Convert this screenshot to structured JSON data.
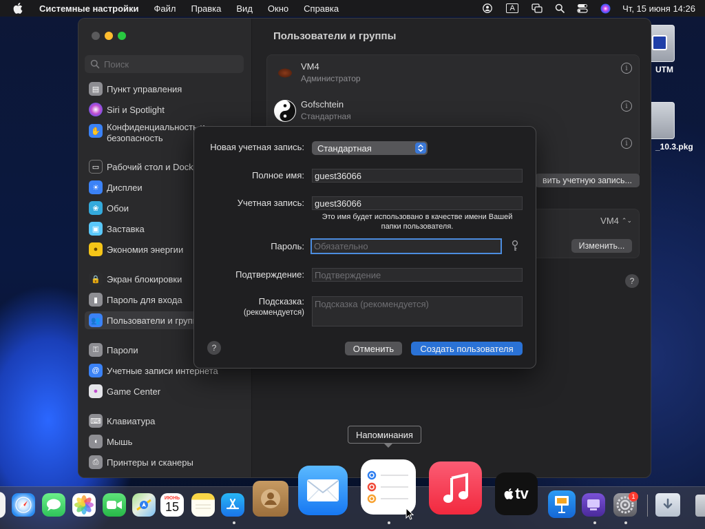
{
  "menubar": {
    "app_name": "Системные настройки",
    "items": [
      "Файл",
      "Правка",
      "Вид",
      "Окно",
      "Справка"
    ],
    "clock": "Чт, 15 июня  14:26",
    "input_source": "A"
  },
  "desktop": {
    "icons": [
      {
        "label": "UTM"
      },
      {
        "label": "_10.3.pkg"
      }
    ]
  },
  "sidebar": {
    "search_placeholder": "Поиск",
    "items": [
      {
        "label": "Пункт управления",
        "color": "#8e8e93"
      },
      {
        "label": "Siri и Spotlight",
        "color": "#c04ccf"
      },
      {
        "label": "Конфиденциальность и",
        "label2": "безопасность",
        "color": "#3b82f6"
      },
      {
        "label": "Рабочий стол и Dock",
        "color": "#2c2c2e"
      },
      {
        "label": "Дисплеи",
        "color": "#3b82f6"
      },
      {
        "label": "Обои",
        "color": "#34aadc"
      },
      {
        "label": "Заставка",
        "color": "#5ac8fa"
      },
      {
        "label": "Экономия энергии",
        "color": "#f5c518"
      },
      {
        "label": "Экран блокировки",
        "color": "#2c2c2e"
      },
      {
        "label": "Пароль для входа",
        "color": "#8e8e93"
      },
      {
        "label": "Пользователи и группы",
        "color": "#3b82f6"
      },
      {
        "label": "Пароли",
        "color": "#8e8e93"
      },
      {
        "label": "Учетные записи интернета",
        "color": "#3b82f6"
      },
      {
        "label": "Game Center",
        "color": "#e5e5ea"
      },
      {
        "label": "Клавиатура",
        "color": "#8e8e93"
      },
      {
        "label": "Мышь",
        "color": "#8e8e93"
      },
      {
        "label": "Принтеры и сканеры",
        "color": "#8e8e93"
      }
    ]
  },
  "content": {
    "title": "Пользователи и группы",
    "users": [
      {
        "name": "VM4",
        "role": "Администратор"
      },
      {
        "name": "Gofschtein",
        "role": "Стандартная"
      }
    ],
    "add_account_button": "вить учетную запись...",
    "autologin_value": "VM4",
    "change_button": "Изменить..."
  },
  "dialog": {
    "account_type_label": "Новая учетная запись:",
    "account_type_value": "Стандартная",
    "full_name_label": "Полное имя:",
    "full_name_value": "guest36066",
    "account_name_label": "Учетная запись:",
    "account_name_value": "guest36066",
    "account_name_note": "Это имя будет использовано в качестве имени Вашей папки пользователя.",
    "password_label": "Пароль:",
    "password_placeholder": "Обязательно",
    "verify_label": "Подтверждение:",
    "verify_placeholder": "Подтверждение",
    "hint_label": "Подсказка:",
    "hint_label2": "(рекомендуется)",
    "hint_placeholder": "Подсказка (рекомендуется)",
    "cancel_button": "Отменить",
    "create_button": "Создать пользователя",
    "help": "?"
  },
  "tooltip": "Напоминания",
  "dock": {
    "calendar_month": "ИЮНЬ",
    "calendar_day": "15",
    "settings_badge": "1",
    "tv_label": "tv"
  },
  "colors": {
    "accent": "#3a78d8",
    "window_bg": "#232325",
    "sidebar_bg": "#2a2a2c",
    "sheet_bg": "#1f1f21"
  }
}
